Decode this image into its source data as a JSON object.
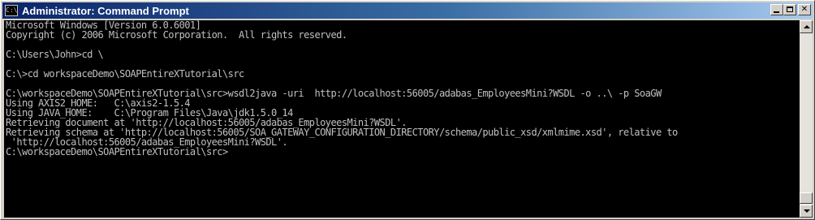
{
  "window": {
    "title": "Administrator: Command Prompt",
    "icon_text": "C:\\",
    "buttons": [
      "minimize",
      "maximize",
      "close"
    ]
  },
  "console": {
    "lines": [
      "Microsoft Windows [Version 6.0.6001]",
      "Copyright (c) 2006 Microsoft Corporation.  All rights reserved.",
      "",
      "C:\\Users\\John>cd \\",
      "",
      "C:\\>cd workspaceDemo\\SOAPEntireXTutorial\\src",
      "",
      "C:\\workspaceDemo\\SOAPEntireXTutorial\\src>wsdl2java -uri  http://localhost:56005/adabas_EmployeesMini?WSDL -o ..\\ -p SoaGW",
      "Using AXIS2_HOME:   C:\\axis2-1.5.4",
      "Using JAVA_HOME:    C:\\Program Files\\Java\\jdk1.5.0_14",
      "Retrieving document at 'http://localhost:56005/adabas_EmployeesMini?WSDL'.",
      "Retrieving schema at 'http://localhost:56005/SOA_GATEWAY_CONFIGURATION_DIRECTORY/schema/public_xsd/xmlmime.xsd', relative to",
      " 'http://localhost:56005/adabas_EmployeesMini?WSDL'.",
      "C:\\workspaceDemo\\SOAPEntireXTutorial\\src>"
    ]
  },
  "colors": {
    "console_background": "#000000",
    "console_text": "#c0c0c0",
    "titlebar_start": "#0a246a",
    "titlebar_end": "#a6caf0"
  }
}
